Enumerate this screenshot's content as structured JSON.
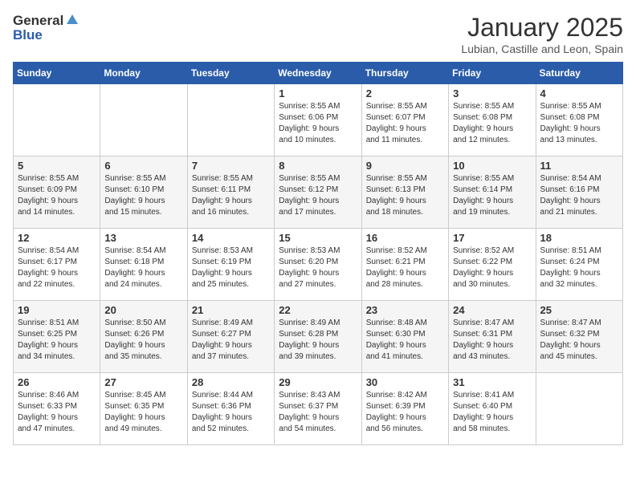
{
  "logo": {
    "line1": "General",
    "line2": "Blue"
  },
  "title": "January 2025",
  "subtitle": "Lubian, Castille and Leon, Spain",
  "weekdays": [
    "Sunday",
    "Monday",
    "Tuesday",
    "Wednesday",
    "Thursday",
    "Friday",
    "Saturday"
  ],
  "weeks": [
    [
      {
        "day": "",
        "info": ""
      },
      {
        "day": "",
        "info": ""
      },
      {
        "day": "",
        "info": ""
      },
      {
        "day": "1",
        "info": "Sunrise: 8:55 AM\nSunset: 6:06 PM\nDaylight: 9 hours\nand 10 minutes."
      },
      {
        "day": "2",
        "info": "Sunrise: 8:55 AM\nSunset: 6:07 PM\nDaylight: 9 hours\nand 11 minutes."
      },
      {
        "day": "3",
        "info": "Sunrise: 8:55 AM\nSunset: 6:08 PM\nDaylight: 9 hours\nand 12 minutes."
      },
      {
        "day": "4",
        "info": "Sunrise: 8:55 AM\nSunset: 6:08 PM\nDaylight: 9 hours\nand 13 minutes."
      }
    ],
    [
      {
        "day": "5",
        "info": "Sunrise: 8:55 AM\nSunset: 6:09 PM\nDaylight: 9 hours\nand 14 minutes."
      },
      {
        "day": "6",
        "info": "Sunrise: 8:55 AM\nSunset: 6:10 PM\nDaylight: 9 hours\nand 15 minutes."
      },
      {
        "day": "7",
        "info": "Sunrise: 8:55 AM\nSunset: 6:11 PM\nDaylight: 9 hours\nand 16 minutes."
      },
      {
        "day": "8",
        "info": "Sunrise: 8:55 AM\nSunset: 6:12 PM\nDaylight: 9 hours\nand 17 minutes."
      },
      {
        "day": "9",
        "info": "Sunrise: 8:55 AM\nSunset: 6:13 PM\nDaylight: 9 hours\nand 18 minutes."
      },
      {
        "day": "10",
        "info": "Sunrise: 8:55 AM\nSunset: 6:14 PM\nDaylight: 9 hours\nand 19 minutes."
      },
      {
        "day": "11",
        "info": "Sunrise: 8:54 AM\nSunset: 6:16 PM\nDaylight: 9 hours\nand 21 minutes."
      }
    ],
    [
      {
        "day": "12",
        "info": "Sunrise: 8:54 AM\nSunset: 6:17 PM\nDaylight: 9 hours\nand 22 minutes."
      },
      {
        "day": "13",
        "info": "Sunrise: 8:54 AM\nSunset: 6:18 PM\nDaylight: 9 hours\nand 24 minutes."
      },
      {
        "day": "14",
        "info": "Sunrise: 8:53 AM\nSunset: 6:19 PM\nDaylight: 9 hours\nand 25 minutes."
      },
      {
        "day": "15",
        "info": "Sunrise: 8:53 AM\nSunset: 6:20 PM\nDaylight: 9 hours\nand 27 minutes."
      },
      {
        "day": "16",
        "info": "Sunrise: 8:52 AM\nSunset: 6:21 PM\nDaylight: 9 hours\nand 28 minutes."
      },
      {
        "day": "17",
        "info": "Sunrise: 8:52 AM\nSunset: 6:22 PM\nDaylight: 9 hours\nand 30 minutes."
      },
      {
        "day": "18",
        "info": "Sunrise: 8:51 AM\nSunset: 6:24 PM\nDaylight: 9 hours\nand 32 minutes."
      }
    ],
    [
      {
        "day": "19",
        "info": "Sunrise: 8:51 AM\nSunset: 6:25 PM\nDaylight: 9 hours\nand 34 minutes."
      },
      {
        "day": "20",
        "info": "Sunrise: 8:50 AM\nSunset: 6:26 PM\nDaylight: 9 hours\nand 35 minutes."
      },
      {
        "day": "21",
        "info": "Sunrise: 8:49 AM\nSunset: 6:27 PM\nDaylight: 9 hours\nand 37 minutes."
      },
      {
        "day": "22",
        "info": "Sunrise: 8:49 AM\nSunset: 6:28 PM\nDaylight: 9 hours\nand 39 minutes."
      },
      {
        "day": "23",
        "info": "Sunrise: 8:48 AM\nSunset: 6:30 PM\nDaylight: 9 hours\nand 41 minutes."
      },
      {
        "day": "24",
        "info": "Sunrise: 8:47 AM\nSunset: 6:31 PM\nDaylight: 9 hours\nand 43 minutes."
      },
      {
        "day": "25",
        "info": "Sunrise: 8:47 AM\nSunset: 6:32 PM\nDaylight: 9 hours\nand 45 minutes."
      }
    ],
    [
      {
        "day": "26",
        "info": "Sunrise: 8:46 AM\nSunset: 6:33 PM\nDaylight: 9 hours\nand 47 minutes."
      },
      {
        "day": "27",
        "info": "Sunrise: 8:45 AM\nSunset: 6:35 PM\nDaylight: 9 hours\nand 49 minutes."
      },
      {
        "day": "28",
        "info": "Sunrise: 8:44 AM\nSunset: 6:36 PM\nDaylight: 9 hours\nand 52 minutes."
      },
      {
        "day": "29",
        "info": "Sunrise: 8:43 AM\nSunset: 6:37 PM\nDaylight: 9 hours\nand 54 minutes."
      },
      {
        "day": "30",
        "info": "Sunrise: 8:42 AM\nSunset: 6:39 PM\nDaylight: 9 hours\nand 56 minutes."
      },
      {
        "day": "31",
        "info": "Sunrise: 8:41 AM\nSunset: 6:40 PM\nDaylight: 9 hours\nand 58 minutes."
      },
      {
        "day": "",
        "info": ""
      }
    ]
  ]
}
